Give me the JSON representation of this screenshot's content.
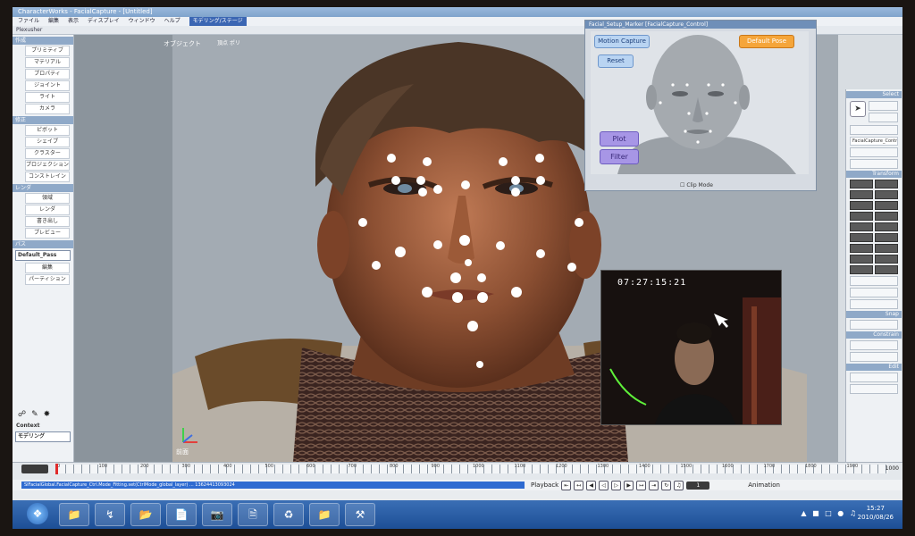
{
  "window": {
    "title": "CharacterWorks - FacialCapture - [Untitled]"
  },
  "menu": {
    "items": [
      "ファイル",
      "編集",
      "表示",
      "ディスプレイ",
      "ウィンドウ",
      "ヘルプ"
    ],
    "mode_label": "モデリング/ステージ"
  },
  "toolbar": {
    "label": "Plexusher"
  },
  "left_panel": {
    "sections": [
      {
        "title": "作成",
        "items": [
          "プリミティブ",
          "マテリアル",
          "プロパティ",
          "ジョイント",
          "ライト",
          "カメラ"
        ]
      },
      {
        "title": "修正",
        "items": [
          "ピボット",
          "シェイプ",
          "クラスター",
          "プロジェクション",
          "コンストレイン"
        ]
      },
      {
        "title": "レンダ",
        "items": [
          "領域",
          "レンダ",
          "書き出し",
          "プレビュー"
        ]
      }
    ],
    "pass_header": "パス",
    "pass_value": "Default_Pass",
    "pass_items": [
      "編集",
      "パーティション"
    ],
    "context_label": "Context",
    "context_value": "モデリング"
  },
  "viewport": {
    "info_left": "オブジェクト",
    "info_right": "頂点 ポリ",
    "bottom_label": "前面"
  },
  "setup_window": {
    "title": "Facial_Setup_Marker [FacialCapture_Control]",
    "capture_button": "Motion Capture",
    "reset_button": "Reset",
    "orange_button": "Default Pose",
    "plot_button": "Plot",
    "filter_button": "Filter",
    "footer": "Clip Mode"
  },
  "camera": {
    "timestamp": "07:27:15:21"
  },
  "right_panel": {
    "select_header": "Select",
    "control_label": "FacialCapture_Control",
    "transform_header": "Transform",
    "snap_header": "Snap",
    "constrain_header": "Constrain",
    "edit_header": "Edit"
  },
  "timeline": {
    "ticks": [
      "0",
      "100",
      "200",
      "300",
      "400",
      "500",
      "600",
      "700",
      "800",
      "900",
      "1000",
      "1100",
      "1200",
      "1300",
      "1400",
      "1500",
      "1600",
      "1700",
      "1800",
      "1900",
      "2000"
    ],
    "end_value": "1000"
  },
  "status": {
    "command": "SIFacialGlobal.FacialCapture_Ctrl.Mode_Fitting.set(CtrlMode_global_layer) ... 13624413093024",
    "playback_label": "Playback",
    "animation_label": "Animation",
    "frame_value": "1"
  },
  "taskbar": {
    "time": "15:27",
    "date": "2010/08/26"
  }
}
